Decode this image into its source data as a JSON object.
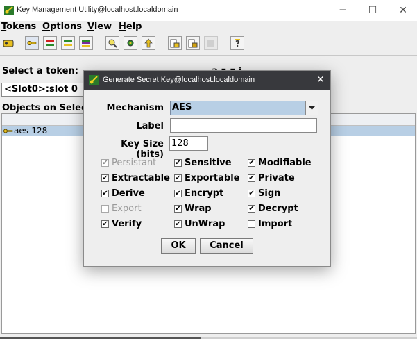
{
  "window": {
    "title": "Key Management Utility@localhost.localdomain",
    "controls": {
      "minimize": "─",
      "maximize": "☐",
      "close": "✕"
    }
  },
  "menu": {
    "tokens": {
      "key": "T",
      "rest": "okens"
    },
    "options": {
      "key": "O",
      "rest": "ptions"
    },
    "view": {
      "key": "V",
      "rest": "iew"
    },
    "help": {
      "key": "H",
      "rest": "elp"
    }
  },
  "toolbar": {
    "buttons": [
      "token-icon",
      "key-icon",
      "key-pair-icon",
      "key-green-icon",
      "key-multi-icon",
      "find-icon",
      "gear-key-icon",
      "key-up-icon",
      "lock-file-icon",
      "lock-file-2-icon",
      "disabled-icon",
      "help-icon"
    ]
  },
  "main": {
    "select_token_label": "Select a token:",
    "token_value": "<Slot0>:slot 0",
    "objects_label": "Objects on Select",
    "behind_fragment": "a ∎ ∎ i",
    "objects": [
      {
        "name": "aes-128"
      }
    ]
  },
  "dialog": {
    "title": "Generate Secret Key@localhost.localdomain",
    "close": "✕",
    "mechanism_label": "Mechanism",
    "mechanism_value": "AES",
    "label_label": "Label",
    "label_value": "",
    "keysize_label": "Key Size (bits)",
    "keysize_value": "128",
    "checkboxes": [
      {
        "label": "Persistant",
        "checked": true,
        "enabled": false
      },
      {
        "label": "Sensitive",
        "checked": true,
        "enabled": true
      },
      {
        "label": "Modifiable",
        "checked": true,
        "enabled": true
      },
      {
        "label": "Extractable",
        "checked": true,
        "enabled": true
      },
      {
        "label": "Exportable",
        "checked": true,
        "enabled": true
      },
      {
        "label": "Private",
        "checked": true,
        "enabled": true
      },
      {
        "label": "Derive",
        "checked": true,
        "enabled": true
      },
      {
        "label": "Encrypt",
        "checked": true,
        "enabled": true
      },
      {
        "label": "Sign",
        "checked": true,
        "enabled": true
      },
      {
        "label": "Export",
        "checked": false,
        "enabled": false
      },
      {
        "label": "Wrap",
        "checked": true,
        "enabled": true
      },
      {
        "label": "Decrypt",
        "checked": true,
        "enabled": true
      },
      {
        "label": "Verify",
        "checked": true,
        "enabled": true
      },
      {
        "label": "UnWrap",
        "checked": true,
        "enabled": true
      },
      {
        "label": "Import",
        "checked": false,
        "enabled": true
      }
    ],
    "ok_label": "OK",
    "cancel_label": "Cancel"
  },
  "colors": {
    "selection": "#b8cfe5",
    "dialog_title_bg": "#38393d",
    "panel_bg": "#eeeeee"
  }
}
